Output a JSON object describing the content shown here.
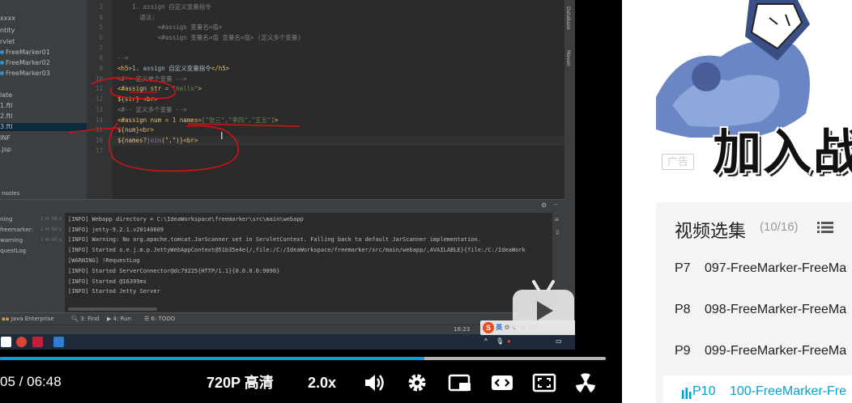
{
  "ide": {
    "tree_items": [
      {
        "label": "xxxx",
        "dot": false
      },
      {
        "label": "ntity",
        "dot": false
      },
      {
        "label": "rvlet",
        "dot": false
      },
      {
        "label": "FreeMarker01",
        "dot": true
      },
      {
        "label": "FreeMarker02",
        "dot": true
      },
      {
        "label": "FreeMarker03",
        "dot": true
      },
      {
        "label": "late",
        "dot": false
      },
      {
        "label": "1.ftl",
        "dot": false
      },
      {
        "label": "2.ftl",
        "dot": false
      },
      {
        "label": "3.ftl",
        "dot": false
      },
      {
        "label": "INF",
        "dot": false
      },
      {
        "label": ".jsp",
        "dot": false
      }
    ],
    "consoles_label": "nsoles",
    "line_numbers": [
      "3",
      "4",
      "5",
      "6",
      "7",
      "8",
      "9",
      "10",
      "11",
      "12",
      "13",
      "14",
      "15",
      "16",
      "17"
    ],
    "code": {
      "l3": "    1. assign 自定义变量指令",
      "l4": "      语法:",
      "l5": "           <#assign 变量名=值>",
      "l6": "           <#assign 变量名=值 变量名=值> (定义多个变量)",
      "l8": "-->",
      "l9_tag": "<h5>",
      "l9_text": "1. assign 自定义变量指令",
      "l9_close": "</h5>",
      "l10": "<#-- 定义单个变量 -->",
      "l11_dir": "<#assign str",
      "l11_eq": " = ",
      "l11_str": "\"hello\"",
      "l11_close": ">",
      "l12": "${str} <br>",
      "l13": "<#-- 定义多个变量 -->",
      "l14_dir": "<#assign num = 1 names=",
      "l14_str": "[\"张三\",\"李四\",\"王五\"]",
      "l14_close": ">",
      "l15": "${num}<br>",
      "l16_pre": "${names?",
      "l16_fn": "join",
      "l16_post": "(\",\")}<br>"
    },
    "right_tabs": [
      "Database",
      "Maven"
    ],
    "run_tree": [
      {
        "label": "ning",
        "time": "1 m 56 s"
      },
      {
        "label": "freemarker:",
        "time": "1 m 50 s"
      },
      {
        "label": "warning",
        "time": "1 m 45 s"
      },
      {
        "label": "questLog",
        "time": ""
      }
    ],
    "console_lines": [
      "[INFO] Webapp directory = C:\\IdeaWorkspace\\freemarker\\src\\main\\webapp",
      "[INFO] jetty-9.2.1.v20140609",
      "[INFO] Warning: No org.apache.tomcat.JarScanner set in ServletContext. Falling back to default JarScanner implementation.",
      "[INFO] Started o.e.j.m.p.JettyWebAppContext@51b35e4e{/,file:/C:/IdeaWorkspace/freemarker/src/main/webapp/,AVAILABLE}{file:/C:/IdeaWork",
      "[WARNING] !RequestLog",
      "[INFO] Started ServerConnector@dc79225{HTTP/1.1}{0.0.0.0:9090}",
      "[INFO] Started @16399ms",
      "[INFO] Started Jetty Server"
    ],
    "tool_windows": [
      "Java Enterprise",
      "3: Find",
      "4: Run",
      "6: TODO"
    ],
    "status_time": "16:23",
    "ime_label": "英"
  },
  "player": {
    "current_time": "05",
    "separator": "/",
    "duration": "06:48",
    "progress_fraction": 0.7,
    "buffer_fraction": 1.0,
    "quality_label": "720P 高清",
    "speed_label": "2.0x",
    "accent_color": "#00a1d6"
  },
  "sidebar": {
    "ad_label": "广告",
    "ad_text": "加入战",
    "playlist_title": "视频选集",
    "playlist_count": "(10/16)",
    "episodes": [
      {
        "num": "P7",
        "title": "097-FreeMarker-FreeMa",
        "active": false
      },
      {
        "num": "P8",
        "title": "098-FreeMarker-FreeMa",
        "active": false
      },
      {
        "num": "P9",
        "title": "099-FreeMarker-FreeMa",
        "active": false
      },
      {
        "num": "P10",
        "title": "100-FreeMarker-Fre",
        "active": true
      }
    ]
  }
}
